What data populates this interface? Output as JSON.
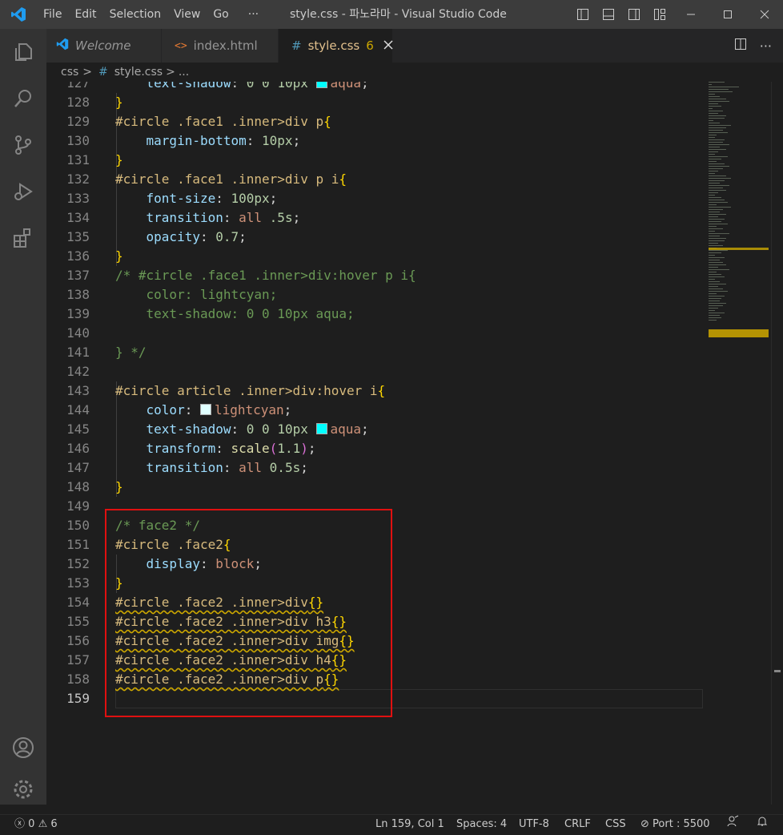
{
  "titlebar": {
    "menu": [
      "File",
      "Edit",
      "Selection",
      "View",
      "Go",
      "···"
    ],
    "title": "style.css - 파노라마 - Visual Studio Code"
  },
  "tabs": [
    {
      "label": "Welcome",
      "icon": "vscode-icon"
    },
    {
      "label": "index.html",
      "icon": "html-icon"
    },
    {
      "label": "style.css",
      "icon": "hash-icon",
      "badge": "6",
      "active": true
    }
  ],
  "breadcrumb": [
    "css",
    ">",
    "#",
    "style.css",
    ">",
    "..."
  ],
  "editor": {
    "lines": [
      {
        "n": "127",
        "tokens": [
          [
            "df",
            "    "
          ],
          [
            "pr",
            "text-shadow"
          ],
          [
            "df",
            ": "
          ],
          [
            "num",
            "0"
          ],
          [
            "df",
            " "
          ],
          [
            "num",
            "0"
          ],
          [
            "df",
            " "
          ],
          [
            "num",
            "10px"
          ],
          [
            "df",
            " "
          ],
          [
            "sw",
            "#00ffff"
          ],
          [
            "val",
            "aqua"
          ],
          [
            "df",
            ";"
          ]
        ]
      },
      {
        "n": "128",
        "tokens": [
          [
            "br",
            "}"
          ]
        ]
      },
      {
        "n": "129",
        "tokens": [
          [
            "sel",
            "#circle .face1 .inner>div p"
          ],
          [
            "br",
            "{"
          ]
        ]
      },
      {
        "n": "130",
        "tokens": [
          [
            "df",
            "    "
          ],
          [
            "pr",
            "margin-bottom"
          ],
          [
            "df",
            ": "
          ],
          [
            "num",
            "10px"
          ],
          [
            "df",
            ";"
          ]
        ]
      },
      {
        "n": "131",
        "tokens": [
          [
            "br",
            "}"
          ]
        ]
      },
      {
        "n": "132",
        "tokens": [
          [
            "sel",
            "#circle .face1 .inner>div p i"
          ],
          [
            "br",
            "{"
          ]
        ]
      },
      {
        "n": "133",
        "tokens": [
          [
            "df",
            "    "
          ],
          [
            "pr",
            "font-size"
          ],
          [
            "df",
            ": "
          ],
          [
            "num",
            "100px"
          ],
          [
            "df",
            ";"
          ]
        ]
      },
      {
        "n": "134",
        "tokens": [
          [
            "df",
            "    "
          ],
          [
            "pr",
            "transition"
          ],
          [
            "df",
            ": "
          ],
          [
            "val",
            "all"
          ],
          [
            "df",
            " "
          ],
          [
            "num",
            ".5s"
          ],
          [
            "df",
            ";"
          ]
        ]
      },
      {
        "n": "135",
        "tokens": [
          [
            "df",
            "    "
          ],
          [
            "pr",
            "opacity"
          ],
          [
            "df",
            ": "
          ],
          [
            "num",
            "0.7"
          ],
          [
            "df",
            ";"
          ]
        ]
      },
      {
        "n": "136",
        "tokens": [
          [
            "br",
            "}"
          ]
        ]
      },
      {
        "n": "137",
        "tokens": [
          [
            "cm",
            "/* #circle .face1 .inner>div:hover p i{"
          ]
        ]
      },
      {
        "n": "138",
        "tokens": [
          [
            "cm",
            "    color: lightcyan;"
          ]
        ]
      },
      {
        "n": "139",
        "tokens": [
          [
            "cm",
            "    text-shadow: 0 0 10px aqua;"
          ]
        ]
      },
      {
        "n": "140",
        "tokens": []
      },
      {
        "n": "141",
        "tokens": [
          [
            "cm",
            "} */"
          ]
        ]
      },
      {
        "n": "142",
        "tokens": []
      },
      {
        "n": "143",
        "tokens": [
          [
            "sel",
            "#circle article .inner>div:hover i"
          ],
          [
            "br",
            "{"
          ]
        ]
      },
      {
        "n": "144",
        "tokens": [
          [
            "df",
            "    "
          ],
          [
            "pr",
            "color"
          ],
          [
            "df",
            ": "
          ],
          [
            "sw",
            "#e0ffff"
          ],
          [
            "val",
            "lightcyan"
          ],
          [
            "df",
            ";"
          ]
        ]
      },
      {
        "n": "145",
        "tokens": [
          [
            "df",
            "    "
          ],
          [
            "pr",
            "text-shadow"
          ],
          [
            "df",
            ": "
          ],
          [
            "num",
            "0"
          ],
          [
            "df",
            " "
          ],
          [
            "num",
            "0"
          ],
          [
            "df",
            " "
          ],
          [
            "num",
            "10px"
          ],
          [
            "df",
            " "
          ],
          [
            "sw",
            "#00ffff"
          ],
          [
            "val",
            "aqua"
          ],
          [
            "df",
            ";"
          ]
        ]
      },
      {
        "n": "146",
        "tokens": [
          [
            "df",
            "    "
          ],
          [
            "pr",
            "transform"
          ],
          [
            "df",
            ": "
          ],
          [
            "fn",
            "scale"
          ],
          [
            "pb",
            "("
          ],
          [
            "num",
            "1.1"
          ],
          [
            "pb",
            ")"
          ],
          [
            "df",
            ";"
          ]
        ]
      },
      {
        "n": "147",
        "tokens": [
          [
            "df",
            "    "
          ],
          [
            "pr",
            "transition"
          ],
          [
            "df",
            ": "
          ],
          [
            "val",
            "all"
          ],
          [
            "df",
            " "
          ],
          [
            "num",
            "0.5s"
          ],
          [
            "df",
            ";"
          ]
        ]
      },
      {
        "n": "148",
        "tokens": [
          [
            "br",
            "}"
          ]
        ]
      },
      {
        "n": "149",
        "tokens": []
      },
      {
        "n": "150",
        "tokens": [
          [
            "cm",
            "/* face2 */"
          ]
        ]
      },
      {
        "n": "151",
        "tokens": [
          [
            "sel",
            "#circle .face2"
          ],
          [
            "br",
            "{"
          ]
        ]
      },
      {
        "n": "152",
        "tokens": [
          [
            "df",
            "    "
          ],
          [
            "pr",
            "display"
          ],
          [
            "df",
            ": "
          ],
          [
            "val",
            "block"
          ],
          [
            "df",
            ";"
          ]
        ]
      },
      {
        "n": "153",
        "tokens": [
          [
            "br",
            "}"
          ]
        ]
      },
      {
        "n": "154",
        "tokens": [
          [
            "sq",
            "#circle .face2 .inner>div"
          ],
          [
            "sqb",
            "{}"
          ]
        ]
      },
      {
        "n": "155",
        "tokens": [
          [
            "sq",
            "#circle .face2 .inner>div h3"
          ],
          [
            "sqb",
            "{}"
          ]
        ]
      },
      {
        "n": "156",
        "tokens": [
          [
            "sq",
            "#circle .face2 .inner>div img"
          ],
          [
            "sqb",
            "{}"
          ]
        ]
      },
      {
        "n": "157",
        "tokens": [
          [
            "sq",
            "#circle .face2 .inner>div h4"
          ],
          [
            "sqb",
            "{}"
          ]
        ]
      },
      {
        "n": "158",
        "tokens": [
          [
            "sq",
            "#circle .face2 .inner>div p"
          ],
          [
            "sqb",
            "{}"
          ]
        ]
      },
      {
        "n": "159",
        "tokens": [],
        "current": true
      }
    ]
  },
  "statusbar": {
    "errors": "0",
    "warnings": "6",
    "position": "Ln 159, Col 1",
    "spaces": "Spaces: 4",
    "encoding": "UTF-8",
    "eol": "CRLF",
    "language": "CSS",
    "port": "Port : 5500"
  },
  "colors": {
    "accent": "#0078d4",
    "highlight_box": "#e01010",
    "warning": "#cca700"
  }
}
